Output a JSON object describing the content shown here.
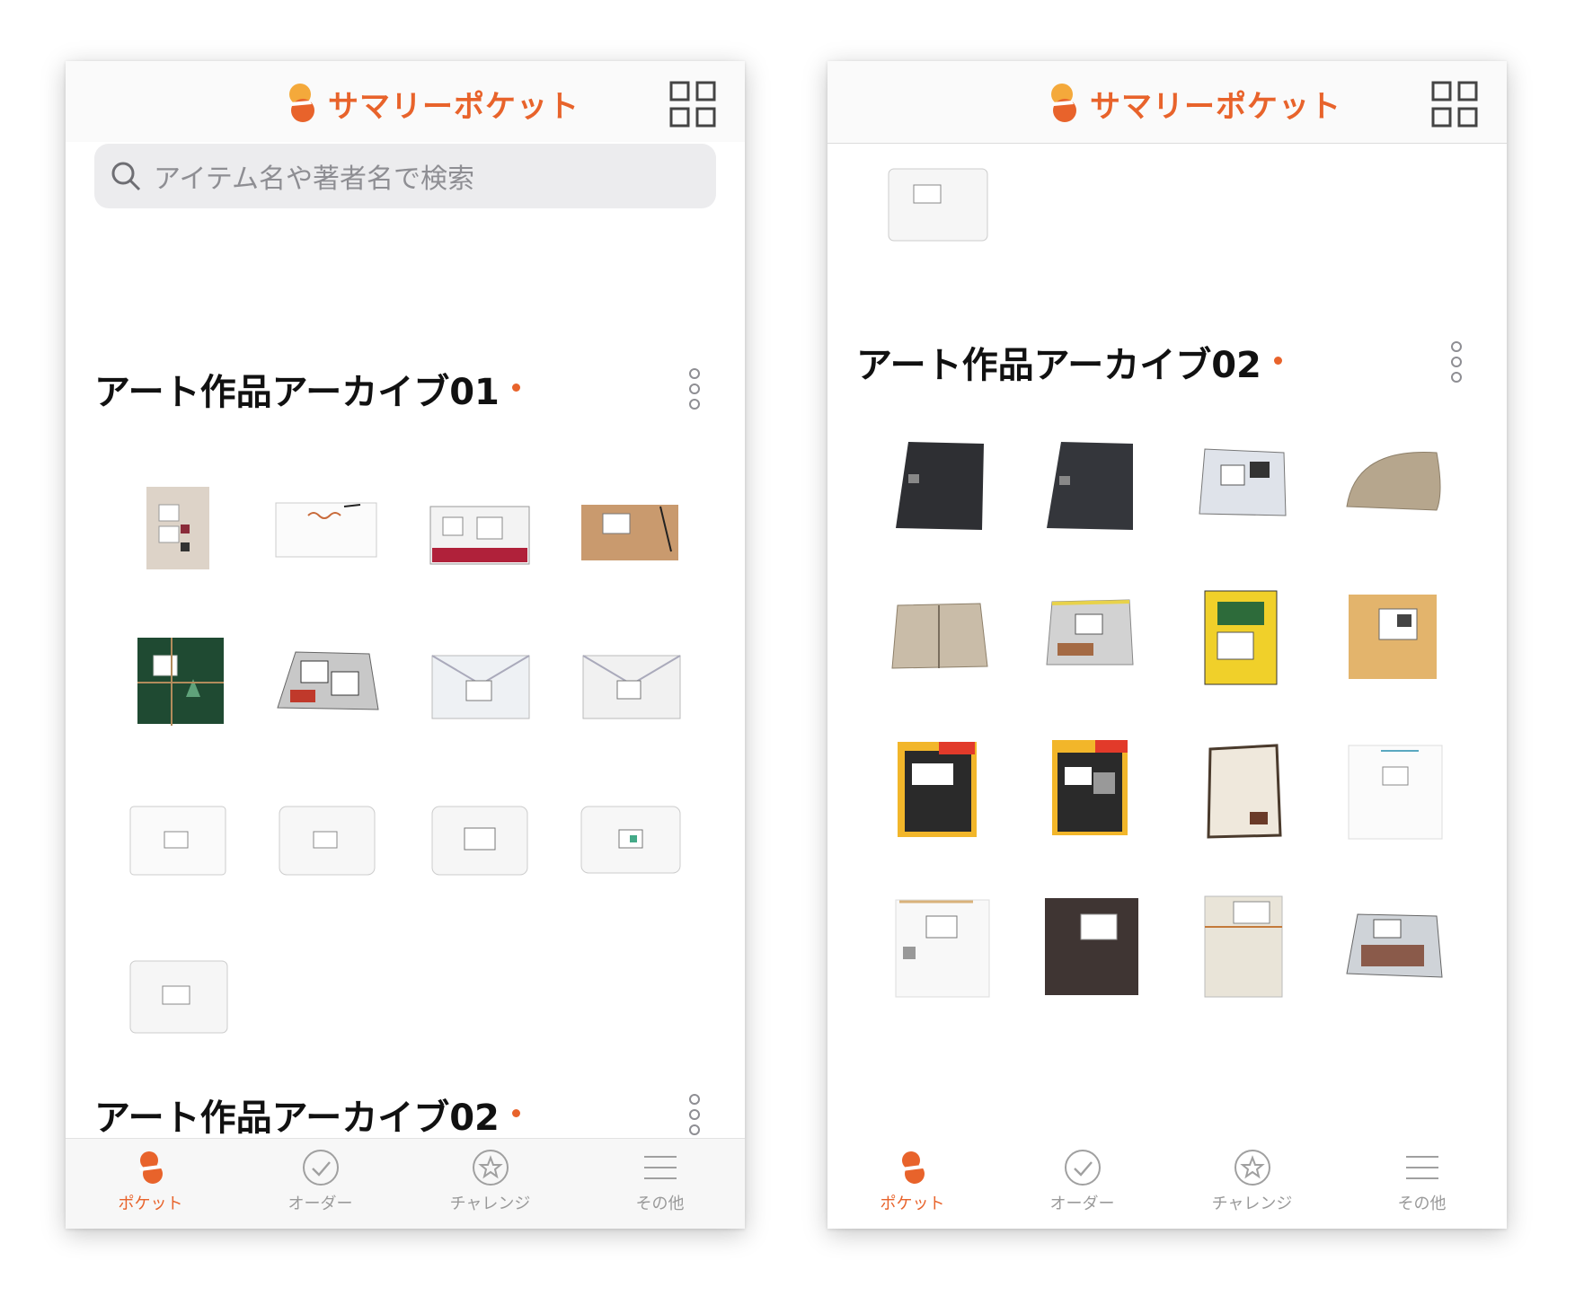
{
  "brand": {
    "name": "サマリーポケット",
    "color": "#e8632b"
  },
  "screens": [
    {
      "header": {
        "logo": "サマリーポケット",
        "grid_icon": "grid-icon"
      },
      "search": {
        "placeholder": "アイテム名や著者名で検索"
      },
      "sections": [
        {
          "title": "アート作品アーカイブ01"
        },
        {
          "title": "アート作品アーカイブ02"
        }
      ],
      "tabs": [
        {
          "label": "ポケット",
          "icon": "pocket-icon",
          "active": true
        },
        {
          "label": "オーダー",
          "icon": "check-circle-icon",
          "active": false
        },
        {
          "label": "チャレンジ",
          "icon": "star-circle-icon",
          "active": false
        },
        {
          "label": "その他",
          "icon": "menu-icon",
          "active": false
        }
      ]
    },
    {
      "header": {
        "logo": "サマリーポケット",
        "grid_icon": "grid-icon"
      },
      "sections": [
        {
          "title": "アート作品アーカイブ02"
        }
      ],
      "tabs": [
        {
          "label": "ポケット",
          "icon": "pocket-icon",
          "active": true
        },
        {
          "label": "オーダー",
          "icon": "check-circle-icon",
          "active": false
        },
        {
          "label": "チャレンジ",
          "icon": "star-circle-icon",
          "active": false
        },
        {
          "label": "その他",
          "icon": "menu-icon",
          "active": false
        }
      ]
    }
  ]
}
